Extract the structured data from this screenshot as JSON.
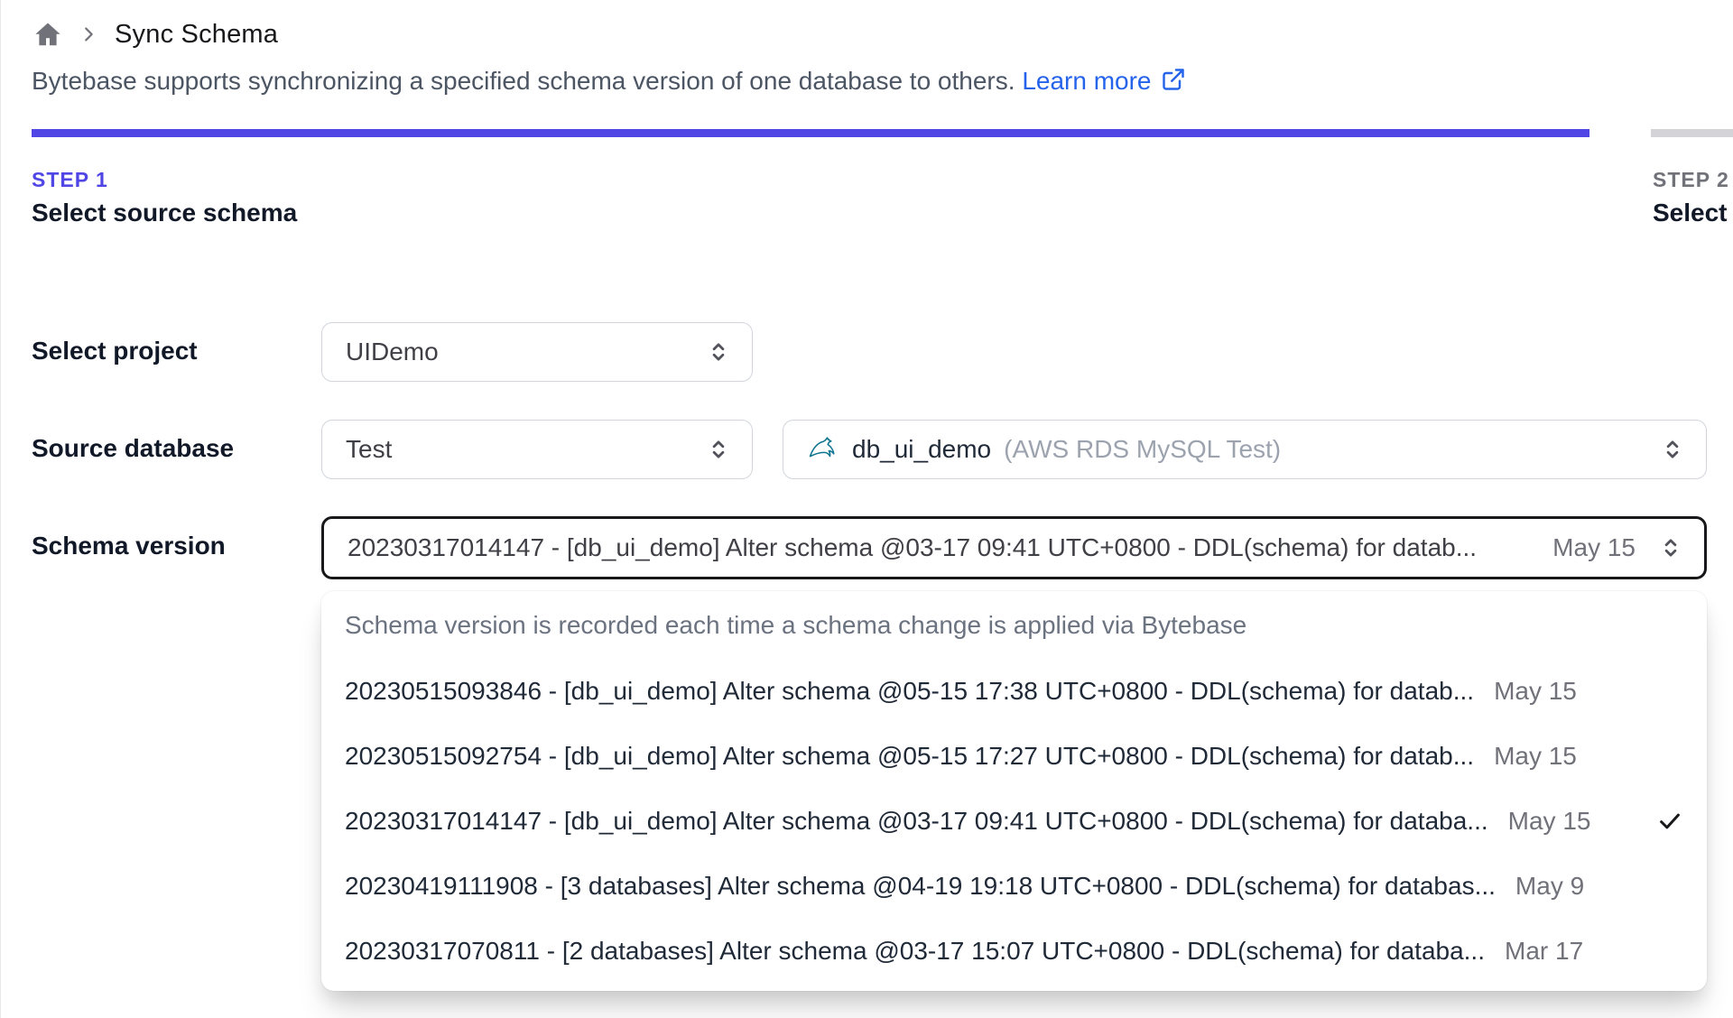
{
  "breadcrumb": {
    "title": "Sync Schema"
  },
  "header": {
    "description": "Bytebase supports synchronizing a specified schema version of one database to others.",
    "learn_more": "Learn more"
  },
  "steps": [
    {
      "label": "STEP 1",
      "title": "Select source schema"
    },
    {
      "label": "STEP 2",
      "title": "Select t"
    }
  ],
  "form": {
    "project": {
      "label": "Select project",
      "value": "UIDemo"
    },
    "source_database": {
      "label": "Source database",
      "environment": "Test",
      "db_icon": "mysql-icon",
      "db_name": "db_ui_demo",
      "db_detail": "(AWS RDS MySQL Test)"
    },
    "schema_version": {
      "label": "Schema version",
      "value": "20230317014147 - [db_ui_demo] Alter schema @03-17 09:41 UTC+0800 - DDL(schema) for datab...",
      "date": "May 15"
    }
  },
  "dropdown": {
    "hint": "Schema version is recorded each time a schema change is applied via Bytebase",
    "options": [
      {
        "text": "20230515093846 - [db_ui_demo] Alter schema @05-15 17:38 UTC+0800 - DDL(schema) for datab...",
        "date": "May 15",
        "selected": false
      },
      {
        "text": "20230515092754 - [db_ui_demo] Alter schema @05-15 17:27 UTC+0800 - DDL(schema) for datab...",
        "date": "May 15",
        "selected": false
      },
      {
        "text": "20230317014147 - [db_ui_demo] Alter schema @03-17 09:41 UTC+0800 - DDL(schema) for databa...",
        "date": "May 15",
        "selected": true
      },
      {
        "text": "20230419111908 - [3 databases] Alter schema @04-19 19:18 UTC+0800 - DDL(schema) for databas...",
        "date": "May 9",
        "selected": false
      },
      {
        "text": "20230317070811 - [2 databases] Alter schema @03-17 15:07 UTC+0800 - DDL(schema) for databa...",
        "date": "Mar 17",
        "selected": false
      }
    ]
  },
  "colors": {
    "accent_indigo": "#4f46e5",
    "link_blue": "#2563eb",
    "inactive_gray": "#d4d4d8",
    "focus_border": "#18181b"
  }
}
